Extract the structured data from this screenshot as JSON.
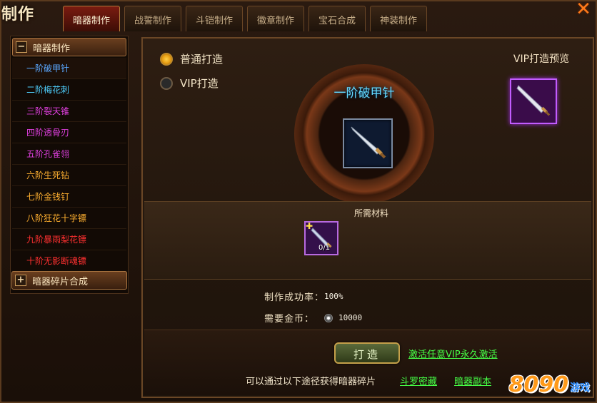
{
  "window": {
    "title": "制作",
    "close_symbol": "✕"
  },
  "tabs": [
    {
      "label": "暗器制作",
      "active": true
    },
    {
      "label": "战誓制作",
      "active": false
    },
    {
      "label": "斗铠制作",
      "active": false
    },
    {
      "label": "徽章制作",
      "active": false
    },
    {
      "label": "宝石合成",
      "active": false
    },
    {
      "label": "神装制作",
      "active": false
    }
  ],
  "sidebar": {
    "group_expanded": {
      "label": "暗器制作",
      "toggle": "−"
    },
    "items": [
      {
        "label": "一阶破甲针",
        "color": "#5aa8ff",
        "selected": true
      },
      {
        "label": "二阶梅花刺",
        "color": "#4fd0ff"
      },
      {
        "label": "三阶裂天锥",
        "color": "#e040e0"
      },
      {
        "label": "四阶透骨刃",
        "color": "#e040e0"
      },
      {
        "label": "五阶孔雀翎",
        "color": "#e040e0"
      },
      {
        "label": "六阶生死钻",
        "color": "#ffb030"
      },
      {
        "label": "七阶金钱钉",
        "color": "#ffb030"
      },
      {
        "label": "八阶狂花十字镖",
        "color": "#ffb030"
      },
      {
        "label": "九阶暴雨梨花镖",
        "color": "#ff3030"
      },
      {
        "label": "十阶无影断魂镖",
        "color": "#ff3030"
      }
    ],
    "group_collapsed": {
      "label": "暗器碎片合成",
      "toggle": "+"
    }
  },
  "main": {
    "options": [
      {
        "label": "普通打造",
        "checked": true
      },
      {
        "label": "VIP打造",
        "checked": false
      }
    ],
    "item_name": "一阶破甲针",
    "vip_preview_title": "VIP打造预览",
    "materials_title": "所需材料",
    "material_count": "0/1",
    "success_label": "制作成功率：",
    "success_value": "100%",
    "gold_label": "需要金币：",
    "gold_value": "10000",
    "craft_button": "打造",
    "vip_link": "激活任意VIP永久激活",
    "hint": "可以通过以下途径获得暗器碎片",
    "source_links": [
      "斗罗密藏",
      "暗器副本"
    ]
  },
  "brand": {
    "number": "8090",
    "text": "游戏"
  },
  "icons": {
    "close": "close-icon",
    "weapon": "dagger-icon",
    "coin": "coin-icon"
  }
}
